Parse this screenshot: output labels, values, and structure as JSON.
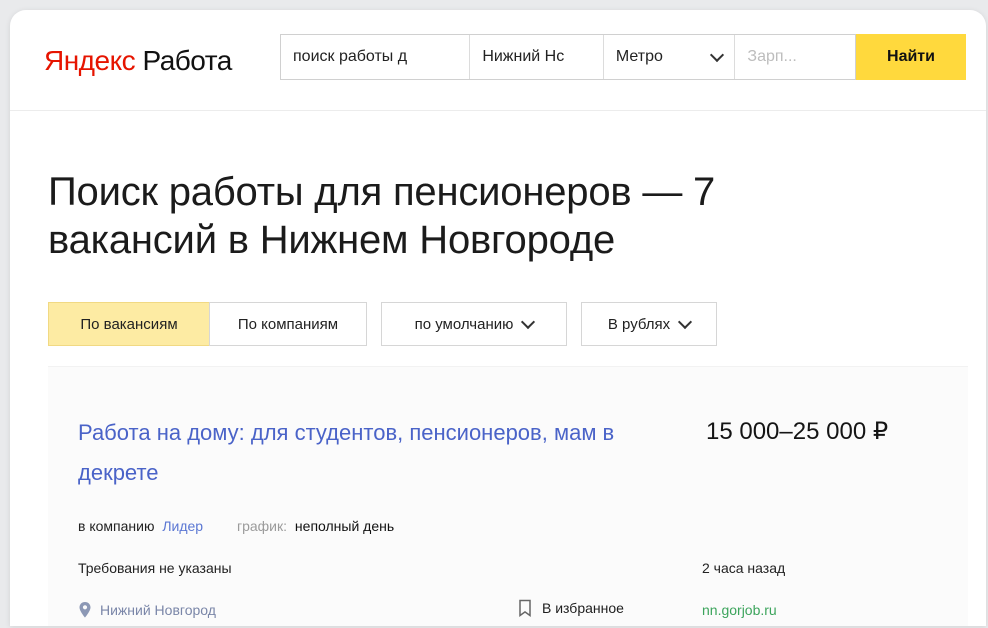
{
  "header": {
    "logo_red": "Яндекс",
    "logo_dark": " Работа",
    "search": {
      "query_value": "поиск работы д",
      "city_value": "Нижний Нс",
      "metro_label": "Метро",
      "salary_placeholder": "Зарп...",
      "find_label": "Найти"
    }
  },
  "page": {
    "title": "Поиск работы для пенсионеров — 7 вакансий в Нижнем Новгороде",
    "filters": {
      "by_vacancies": "По вакансиям",
      "by_companies": "По компаниям",
      "sort": "по умолчанию",
      "currency": "В рублях"
    }
  },
  "job": {
    "title": "Работа на дому: для студентов, пенсионеров, мам в декрете",
    "salary": "15 000–25 000 ₽",
    "company_prefix": "в компанию",
    "company_name": "Лидер",
    "schedule_label": "график:",
    "schedule_value": "неполный день",
    "requirements": "Требования не указаны",
    "posted": "2 часа назад",
    "location": "Нижний Новгород",
    "favorite": "В избранное",
    "source": "nn.gorjob.ru"
  },
  "colors": {
    "brand_red": "#e61400",
    "accent_yellow": "#ffd93d",
    "active_filter": "#fdeba3",
    "link_blue": "#4a63c8",
    "source_green": "#3ca45c"
  },
  "icons": {
    "metro": "chevron-down-icon",
    "sort": "chevron-down-icon",
    "currency": "chevron-down-icon",
    "location": "map-pin-icon",
    "favorite": "bookmark-icon"
  }
}
